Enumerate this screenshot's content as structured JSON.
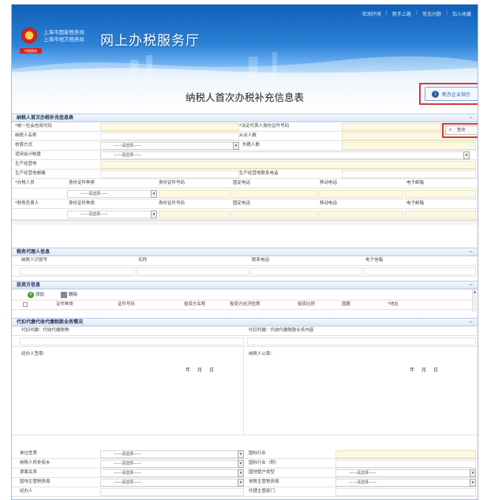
{
  "topnav": {
    "items": [
      "检测环境",
      "新手上路",
      "常见问题",
      "加入收藏"
    ]
  },
  "header": {
    "bureau_lines": [
      "上海市国家税务局",
      "上海市地方税务局"
    ],
    "seal": "中国税务",
    "site_title": "网上办税服务厅"
  },
  "page": {
    "title": "纳税人首次办税补充信息表",
    "guide_button": "新办企业指引"
  },
  "section1": {
    "header": "纳税人首次办税补充信息表",
    "labels": {
      "credit_code": "*统一社会信用代码",
      "legal_id": "*法定代表人身份证件号码",
      "taxpayer_name": "纳税人名称",
      "employees": "从业人数",
      "accounting": "核算方式",
      "foreign_count": "外籍人数",
      "acct_system": "适用会计制度",
      "biz_address": "生产经营地",
      "biz_phone": "生产经营地邮编",
      "biz_contact": "生产经营地联系电话",
      "tax_officer": "*办税人员",
      "fin_officer": "*财务负责人"
    },
    "search_button": "查询",
    "person_cols": [
      "身份证件种类",
      "身份证件号码",
      "固定电话",
      "移动电话",
      "电子邮箱"
    ],
    "select_placeholder": "——请选择——"
  },
  "section2": {
    "header": "税务代理人信息",
    "cols": [
      "纳税人识别号",
      "名称",
      "联系电话",
      "电子信箱"
    ]
  },
  "section3": {
    "header": "投资方信息",
    "add_button": "添加",
    "delete_button": "删除",
    "cols": [
      "证件种类",
      "证件号码",
      "投资方名称",
      "投资方经济性质",
      "投资比例",
      "国籍",
      "*地址"
    ]
  },
  "section4": {
    "header": "代扣代缴代收代缴税款业务情况",
    "left_label": "代扣代缴：代收代缴税种",
    "right_label": "代扣代缴：代收代缴税款业务内容",
    "left_sign": "经办人签章：",
    "right_sign": "纳税人公章：",
    "date_text": "年月日"
  },
  "section5": {
    "left_labels": [
      "单位性质",
      "纳税人所处街乡",
      "隶属关系",
      "国地主管税务局",
      "经办人"
    ],
    "right_labels": [
      "国标行业",
      "国标行业（附）",
      "国地管户类型",
      "地税主管税务局",
      "代理主管部门"
    ],
    "select_placeholder": "——请选择——"
  }
}
